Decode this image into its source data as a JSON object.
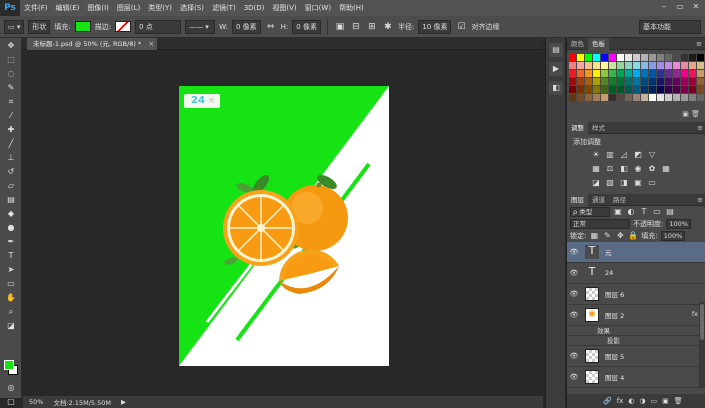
{
  "menu": {
    "logo": "Ps",
    "items": [
      "文件(F)",
      "编辑(E)",
      "图像(I)",
      "图层(L)",
      "类型(Y)",
      "选择(S)",
      "滤镜(T)",
      "3D(D)",
      "视图(V)",
      "窗口(W)",
      "帮助(H)"
    ]
  },
  "window_controls": {
    "minimize": "–",
    "restore": "▭",
    "close": "✕"
  },
  "options": {
    "shape_mode": "形状",
    "fill_label": "填充:",
    "fill_color": "#16e314",
    "stroke_label": "描边:",
    "stroke_width": "0 点",
    "w_label": "W:",
    "w_value": "0 像素",
    "link_icon": "⇔",
    "h_label": "H:",
    "h_value": "0 像素",
    "radius_label": "半径:",
    "radius_value": "10 像素",
    "align_edges": "对齐边缘",
    "workspace": "基本功能"
  },
  "document": {
    "tab_title": "未标题-1.psd @ 50% (元, RGB/8) *",
    "close": "×",
    "badge_number": "24",
    "badge_unit": "元"
  },
  "status": {
    "zoom": "50%",
    "doc_size": "文档:2.15M/5.50M",
    "arrow": "▶"
  },
  "colors": {
    "canvas_green": "#16e314",
    "canvas_white": "#ffffff",
    "selection_blue": "#5a6c85"
  },
  "panels": {
    "swatch_tabs": [
      "颜色",
      "色板"
    ],
    "adjust_tabs": [
      "调整",
      "样式"
    ],
    "adjust_title": "添加调整",
    "layers_tabs": [
      "图层",
      "通道",
      "路径"
    ],
    "kind_select": "ρ 类型",
    "blend_mode": "正常",
    "opacity_label": "不透明度:",
    "opacity_value": "100%",
    "lock_label": "锁定:",
    "fill_label": "填充:",
    "fill_value": "100%",
    "layers": [
      {
        "name": "元",
        "type": "text",
        "selected": true
      },
      {
        "name": "24",
        "type": "text",
        "selected": false
      },
      {
        "name": "图层 6",
        "type": "raster",
        "selected": false
      },
      {
        "name": "图层 2",
        "type": "raster",
        "selected": false,
        "fx": "fx"
      },
      {
        "name": "图层 5",
        "type": "raster",
        "selected": false
      },
      {
        "name": "图层 4",
        "type": "raster",
        "selected": false
      }
    ],
    "effects_label": "效果",
    "drop_shadow_label": "投影",
    "swatch_colors": [
      "#ff0000",
      "#ffff00",
      "#00ff00",
      "#00ffff",
      "#0000ff",
      "#ff00ff",
      "#ffffff",
      "#e6e6e6",
      "#cccccc",
      "#b3b3b3",
      "#999999",
      "#808080",
      "#666666",
      "#4d4d4d",
      "#333333",
      "#1a1a1a",
      "#000000",
      "#f08080",
      "#f5a5a5",
      "#f7c08a",
      "#f9e28a",
      "#fff59a",
      "#c9e59a",
      "#9ad49a",
      "#8ad4c0",
      "#8ad8e6",
      "#8ab8e6",
      "#8a9ae6",
      "#a58ae6",
      "#c08ae6",
      "#e68ad4",
      "#e68aa5",
      "#e6a58a",
      "#d4c08a",
      "#ed1c24",
      "#f26522",
      "#f7941d",
      "#fff200",
      "#8dc63f",
      "#39b54a",
      "#00a651",
      "#00a99d",
      "#00aeef",
      "#0072bc",
      "#0054a6",
      "#2e3192",
      "#662d91",
      "#92278f",
      "#ec008c",
      "#ed145b",
      "#c69c6d",
      "#9e0b0f",
      "#a0410d",
      "#a36209",
      "#aba000",
      "#598527",
      "#1a7b30",
      "#007236",
      "#00746b",
      "#0076a3",
      "#004b80",
      "#003471",
      "#1b1464",
      "#440e62",
      "#630460",
      "#9e005d",
      "#9e0039",
      "#8c6239",
      "#790000",
      "#7b2e00",
      "#7d4900",
      "#827b00",
      "#406618",
      "#005e20",
      "#005826",
      "#005952",
      "#005b7f",
      "#003663",
      "#002157",
      "#0d004c",
      "#32004b",
      "#4b0049",
      "#7b0046",
      "#7a0026",
      "#754c24",
      "#603913",
      "#754c24",
      "#8c6239",
      "#a67c52",
      "#c69c6d",
      "#362f2d",
      "#534741",
      "#736357",
      "#998675",
      "#c7b299",
      "#ffffff",
      "#e6e6e6",
      "#cccccc",
      "#b3b3b3",
      "#999999",
      "#808080",
      "#666666"
    ],
    "layer_actions": [
      "🔗",
      "fx",
      "◐",
      "◑",
      "▭",
      "▣",
      "🗑"
    ]
  }
}
